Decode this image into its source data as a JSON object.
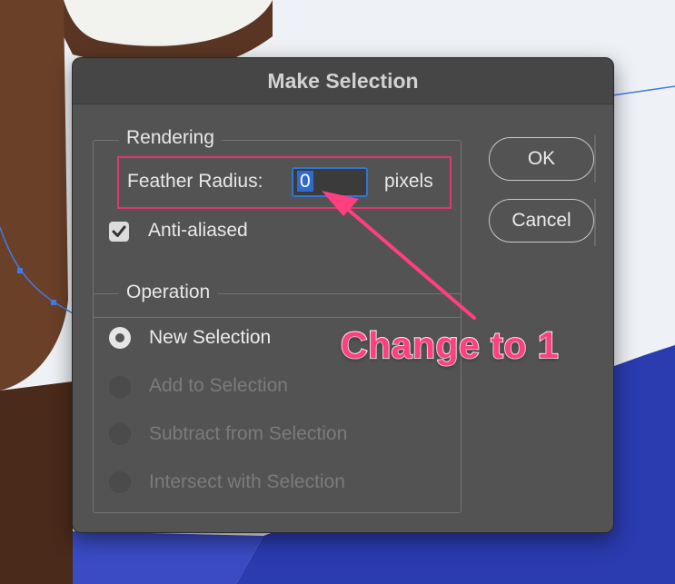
{
  "dialog": {
    "title": "Make Selection",
    "rendering": {
      "legend": "Rendering",
      "feather_label": "Feather Radius:",
      "feather_value": "0",
      "feather_unit": "pixels",
      "anti_aliased_label": "Anti-aliased",
      "anti_aliased_checked": true
    },
    "operation": {
      "legend": "Operation",
      "options": [
        {
          "label": "New Selection",
          "selected": true,
          "enabled": true
        },
        {
          "label": "Add to Selection",
          "selected": false,
          "enabled": false
        },
        {
          "label": "Subtract from Selection",
          "selected": false,
          "enabled": false
        },
        {
          "label": "Intersect with Selection",
          "selected": false,
          "enabled": false
        }
      ]
    },
    "buttons": {
      "ok": "OK",
      "cancel": "Cancel"
    }
  },
  "annotation": {
    "text": "Change to 1",
    "color": "#ff3f7f"
  },
  "colors": {
    "dialog_bg": "#535353",
    "input_focus": "#2f76d8",
    "highlight_box": "#e0366f",
    "shirt_blue": "#2b3bb0"
  }
}
